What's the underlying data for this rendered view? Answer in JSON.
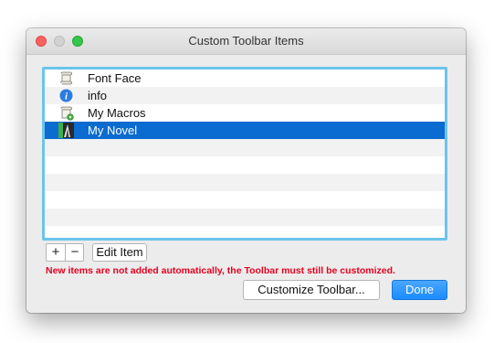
{
  "window": {
    "title": "Custom Toolbar Items"
  },
  "items": [
    {
      "label": "Font Face",
      "icon": "scroll-icon"
    },
    {
      "label": "info",
      "icon": "info-icon"
    },
    {
      "label": "My Macros",
      "icon": "scroll-gear-icon"
    },
    {
      "label": "My Novel",
      "icon": "novel-icon",
      "selected": true
    }
  ],
  "controls": {
    "add_symbol": "+",
    "remove_symbol": "−",
    "edit_label": "Edit Item",
    "warning": "New items are not added automatically, the Toolbar must still be customized.",
    "customize_label": "Customize Toolbar...",
    "done_label": "Done"
  },
  "colors": {
    "selection": "#0a6bd0",
    "focus_ring": "#6cc4ea",
    "warning_text": "#e6001f",
    "default_button": "#1a8cff"
  }
}
